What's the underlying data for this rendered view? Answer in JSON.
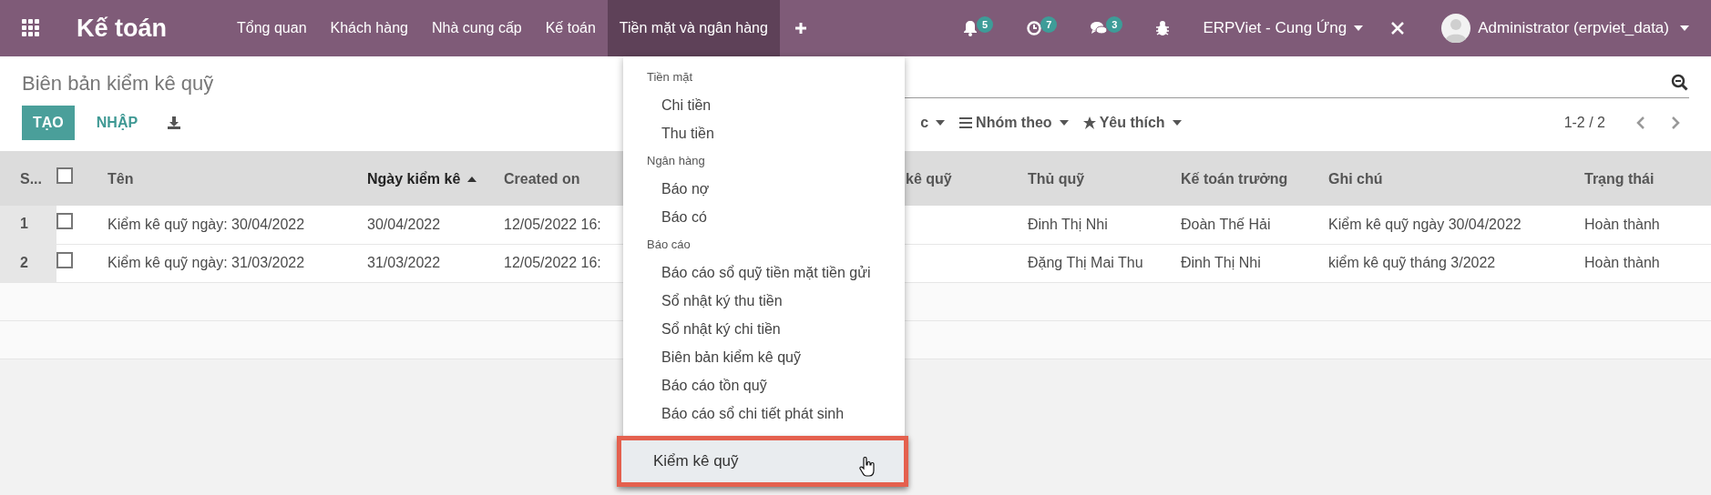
{
  "navbar": {
    "app_title": "Kế toán",
    "menu": [
      {
        "label": "Tổng quan",
        "selected": false
      },
      {
        "label": "Khách hàng",
        "selected": false
      },
      {
        "label": "Nhà cung cấp",
        "selected": false
      },
      {
        "label": "Kế toán",
        "selected": false
      },
      {
        "label": "Tiền mặt và ngân hàng",
        "selected": true
      }
    ],
    "systray": [
      {
        "kind": "bell",
        "count": "5"
      },
      {
        "kind": "clock",
        "count": "7"
      },
      {
        "kind": "chat",
        "count": "3"
      },
      {
        "kind": "bug"
      }
    ],
    "company": "ERPViet - Cung Ứng",
    "user": "Administrator (erpviet_data)"
  },
  "page_title": "Biên bản kiểm kê quỹ",
  "buttons": {
    "create": "TẠO",
    "import": "NHẬP"
  },
  "filters": [
    {
      "kind": "filter",
      "label": "c"
    },
    {
      "kind": "group",
      "label": "Nhóm theo"
    },
    {
      "kind": "favorite",
      "label": "Yêu thích"
    }
  ],
  "pager": "1-2 / 2",
  "table": {
    "all_checked": false,
    "columns": [
      {
        "label": "S...",
        "sorted": false
      },
      {
        "label": "Tên",
        "sorted": false
      },
      {
        "label": "Ngày kiểm kê",
        "sorted": true
      },
      {
        "label": "Created on",
        "sorted": false
      },
      {
        "label": "kê quỹ",
        "sorted": false
      },
      {
        "label": "Thủ quỹ",
        "sorted": false
      },
      {
        "label": "Kế toán trưởng",
        "sorted": false
      },
      {
        "label": "Ghi chú",
        "sorted": false
      },
      {
        "label": "Trạng thái",
        "sorted": false
      }
    ],
    "rows": [
      {
        "checked": false,
        "cells": [
          "1",
          "Kiểm kê quỹ ngày: 30/04/2022",
          "30/04/2022",
          "12/05/2022 16:",
          "",
          "Đinh Thị Nhi",
          "Đoàn Thế Hải",
          "Kiểm kê quỹ ngày 30/04/2022",
          "Hoàn thành"
        ]
      },
      {
        "checked": false,
        "cells": [
          "2",
          "Kiểm kê quỹ ngày: 31/03/2022",
          "31/03/2022",
          "12/05/2022 16:",
          "",
          "Đặng Thị Mai Thu",
          "Đinh Thị Nhi",
          "kiểm kê quỹ tháng 3/2022",
          "Hoàn thành"
        ]
      }
    ]
  },
  "dropdown": {
    "items": [
      {
        "kind": "header",
        "label": "Tiền mặt"
      },
      {
        "kind": "item",
        "label": "Chi tiền"
      },
      {
        "kind": "item",
        "label": "Thu tiền"
      },
      {
        "kind": "header",
        "label": "Ngân hàng"
      },
      {
        "kind": "item",
        "label": "Báo nợ"
      },
      {
        "kind": "item",
        "label": "Báo có"
      },
      {
        "kind": "header",
        "label": "Báo cáo"
      },
      {
        "kind": "item",
        "label": "Báo cáo sổ quỹ tiền mặt tiền gửi"
      },
      {
        "kind": "item",
        "label": "Sổ nhật ký thu tiền"
      },
      {
        "kind": "item",
        "label": "Sổ nhật ký chi tiền"
      },
      {
        "kind": "item",
        "label": "Biên bản kiểm kê quỹ"
      },
      {
        "kind": "item",
        "label": "Báo cáo tồn quỹ"
      },
      {
        "kind": "item",
        "label": "Báo cáo sổ chi tiết phát sinh"
      }
    ],
    "highlighted": "Kiểm kê quỹ"
  }
}
